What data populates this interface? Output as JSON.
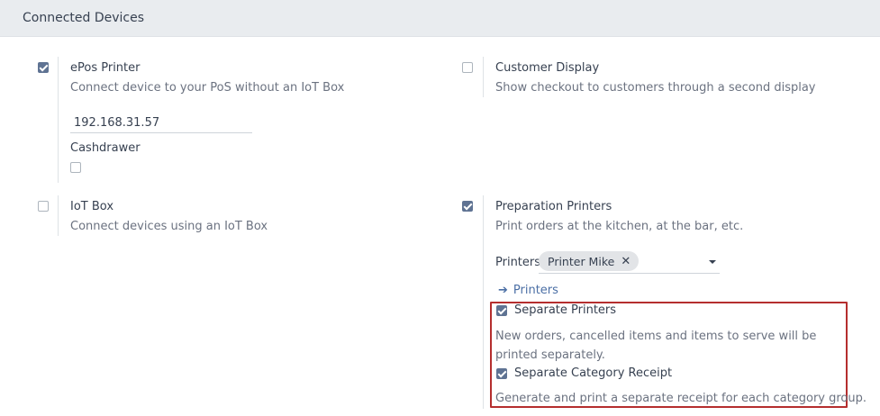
{
  "header": {
    "title": "Connected Devices"
  },
  "epos": {
    "checked": true,
    "title": "ePos Printer",
    "description": "Connect device to your PoS without an IoT Box",
    "ip_value": "192.168.31.57",
    "cashdrawer_label": "Cashdrawer",
    "cashdrawer_checked": false
  },
  "customer_display": {
    "checked": false,
    "title": "Customer Display",
    "description": "Show checkout to customers through a second display"
  },
  "iot_box": {
    "checked": false,
    "title": "IoT Box",
    "description": "Connect devices using an IoT Box"
  },
  "preparation_printers": {
    "checked": true,
    "title": "Preparation Printers",
    "description": "Print orders at the kitchen, at the bar, etc.",
    "printers_label": "Printers",
    "printer_tags": [
      "Printer Mike"
    ],
    "remove_symbol": "✕",
    "link_arrow": "➔",
    "link_label": "Printers",
    "separate_printers": {
      "checked": true,
      "label": "Separate Printers",
      "description": "New orders, cancelled items and items to serve will be printed separately."
    },
    "separate_category_receipt": {
      "checked": true,
      "label": "Separate Category Receipt",
      "description": "Generate and print a separate receipt for each category group."
    }
  },
  "colors": {
    "checkbox_checked": "#5f7393",
    "link": "#4b6fa5",
    "highlight_border": "#b52e2e",
    "header_bg": "#e9ecef"
  }
}
